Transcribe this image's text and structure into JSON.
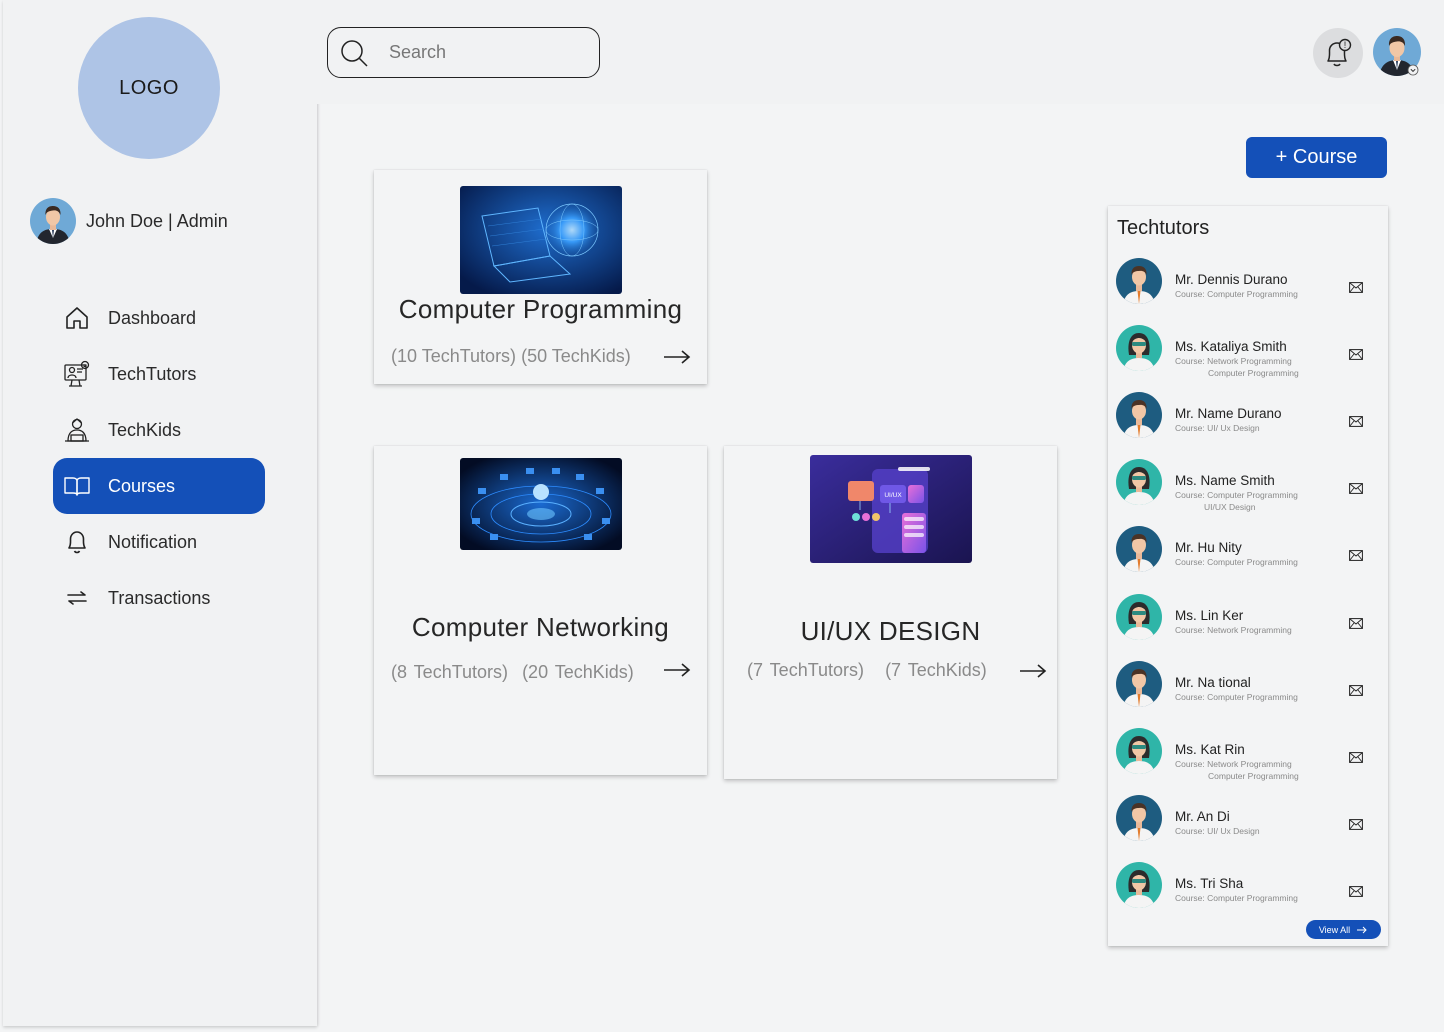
{
  "logo": "LOGO",
  "user": {
    "name": "John Doe | Admin"
  },
  "nav": [
    {
      "label": "Dashboard",
      "icon": "home-icon",
      "active": false
    },
    {
      "label": "TechTutors",
      "icon": "tutor-icon",
      "active": false
    },
    {
      "label": "TechKids",
      "icon": "kids-icon",
      "active": false
    },
    {
      "label": "Courses",
      "icon": "book-icon",
      "active": true
    },
    {
      "label": "Notification",
      "icon": "bell-icon",
      "active": false
    },
    {
      "label": "Transactions",
      "icon": "transfer-icon",
      "active": false
    }
  ],
  "search": {
    "placeholder": "Search",
    "value": ""
  },
  "header": {
    "notification_badge": "!"
  },
  "add_course_label": "+ Course",
  "courses": [
    {
      "title": "Computer Programming",
      "tutors": "(10 TechTutors)",
      "kids": "(50 TechKids)",
      "image": "laptop-globe-image"
    },
    {
      "title": "Computer Networking",
      "tutors": "(8 TechTutors)",
      "kids": "(20 TechKids)",
      "image": "network-image"
    },
    {
      "title": "UI/UX DESIGN",
      "tutors": "(7 TechTutors)",
      "kids": "(7 TechKids)",
      "image": "uiux-image"
    }
  ],
  "uiux_image_text": "UI/UX",
  "panel": {
    "title": "Techtutors",
    "view_all": "View All",
    "tutors": [
      {
        "name": "Mr. Dennis Durano",
        "course": "Course: Computer Programming",
        "course2": ""
      },
      {
        "name": "Ms. Kataliya Smith",
        "course": "Course: Network Programming",
        "course2": "Computer Programming"
      },
      {
        "name": "Mr. Name Durano",
        "course": "Course: UI/ Ux Design",
        "course2": ""
      },
      {
        "name": "Ms. Name Smith",
        "course": "Course: Computer Programming",
        "course2": "UI/UX Design"
      },
      {
        "name": "Mr. Hu Nity",
        "course": "Course: Computer Programming",
        "course2": ""
      },
      {
        "name": "Ms. Lin Ker",
        "course": "Course: Network Programming",
        "course2": ""
      },
      {
        "name": "Mr. Na tional",
        "course": "Course: Computer Programming",
        "course2": ""
      },
      {
        "name": "Ms. Kat Rin",
        "course": "Course: Network Programming",
        "course2": "Computer Programming"
      },
      {
        "name": "Mr. An Di",
        "course": "Course: UI/ Ux Design",
        "course2": ""
      },
      {
        "name": "Ms. Tri Sha",
        "course": "Course: Computer Programming",
        "course2": ""
      }
    ]
  },
  "colors": {
    "accent": "#1450b8",
    "logo_bg": "#aec4e6",
    "male_avatar_bg": "#1e5c80",
    "female_avatar_bg": "#2fb5a8"
  }
}
